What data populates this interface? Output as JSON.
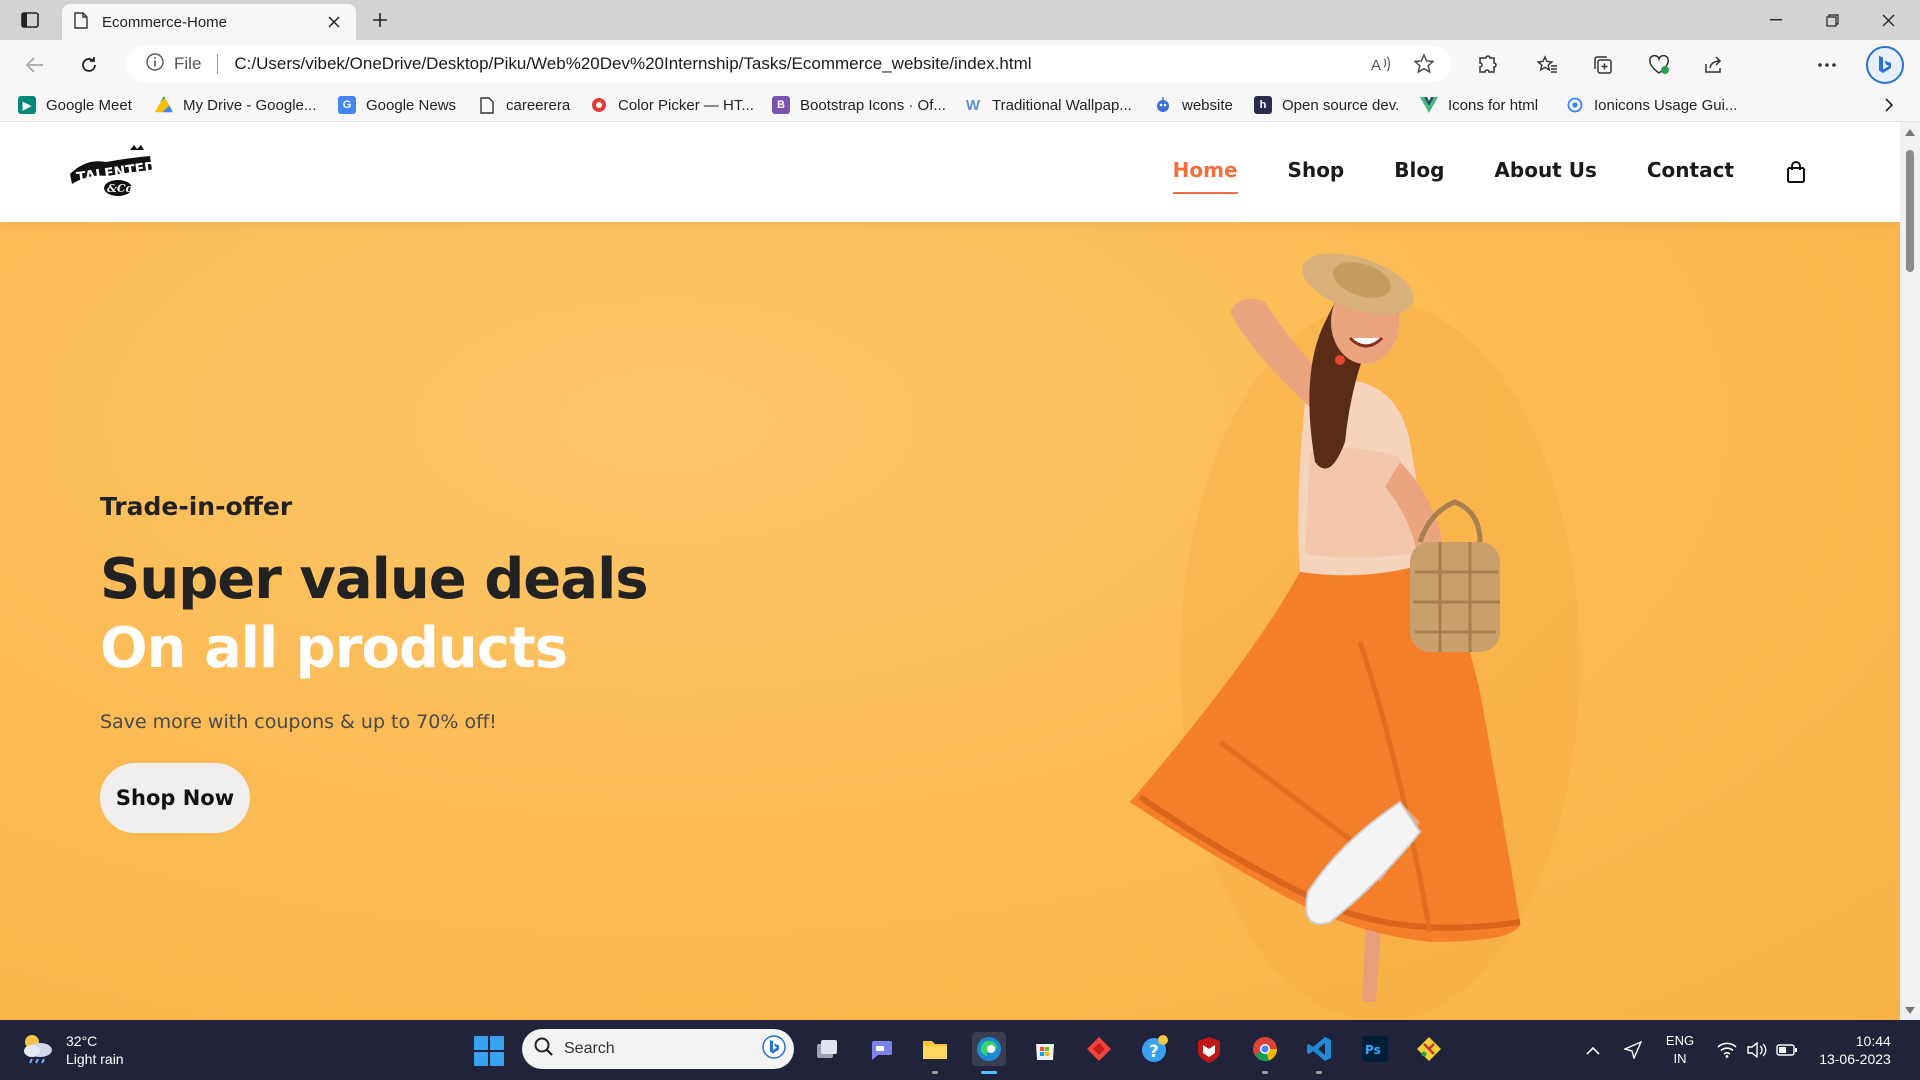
{
  "browser": {
    "tab_title": "Ecommerce-Home",
    "address_scheme_label": "File",
    "url": "C:/Users/vibek/OneDrive/Desktop/Piku/Web%20Dev%20Internship/Tasks/Ecommerce_website/index.html"
  },
  "bookmarks": [
    {
      "label": "Google Meet",
      "icon": "google-meet-icon",
      "color": "#00897b"
    },
    {
      "label": "My Drive - Google...",
      "icon": "google-drive-icon",
      "color": "#fbbc04"
    },
    {
      "label": "Google News",
      "icon": "google-news-icon",
      "color": "#4285f4"
    },
    {
      "label": "careerera",
      "icon": "page-icon",
      "color": "#555555"
    },
    {
      "label": "Color Picker — HT...",
      "icon": "color-picker-icon",
      "color": "#e53935"
    },
    {
      "label": "Bootstrap Icons · Of...",
      "icon": "bootstrap-icon",
      "color": "#7952b3"
    },
    {
      "label": "Traditional Wallpap...",
      "icon": "wallpaper-icon",
      "color": "#5c8ddb"
    },
    {
      "label": "website",
      "icon": "website-icon",
      "color": "#3b6fd4"
    },
    {
      "label": "Open source dev.",
      "icon": "hashnode-icon",
      "color": "#2b2b4d"
    },
    {
      "label": "Icons for html",
      "icon": "vue-icon",
      "color": "#42b883"
    },
    {
      "label": "Ionicons Usage Gui...",
      "icon": "ionicons-icon",
      "color": "#3880ff"
    }
  ],
  "site": {
    "nav": [
      {
        "label": "Home",
        "active": true
      },
      {
        "label": "Shop",
        "active": false
      },
      {
        "label": "Blog",
        "active": false
      },
      {
        "label": "About Us",
        "active": false
      },
      {
        "label": "Contact",
        "active": false
      }
    ],
    "accent_color": "#f36e3c",
    "hero": {
      "kicker": "Trade-in-offer",
      "headline_dark": "Super value deals",
      "headline_light": "On all products",
      "subtitle": "Save more with coupons & up to 70% off!",
      "cta_label": "Shop Now",
      "background_color": "#fcbb55"
    }
  },
  "taskbar": {
    "weather_temp": "32°C",
    "weather_desc": "Light rain",
    "search_placeholder": "Search",
    "lang_line1": "ENG",
    "lang_line2": "IN",
    "time": "10:44",
    "date": "13-06-2023",
    "apps": [
      "task-view-icon",
      "teams-chat-icon",
      "file-explorer-icon",
      "edge-browser-icon",
      "microsoft-store-icon",
      "anydesk-icon",
      "help-icon",
      "mcafee-icon",
      "chrome-icon",
      "vscode-icon",
      "photoshop-icon",
      "git-icon"
    ]
  }
}
